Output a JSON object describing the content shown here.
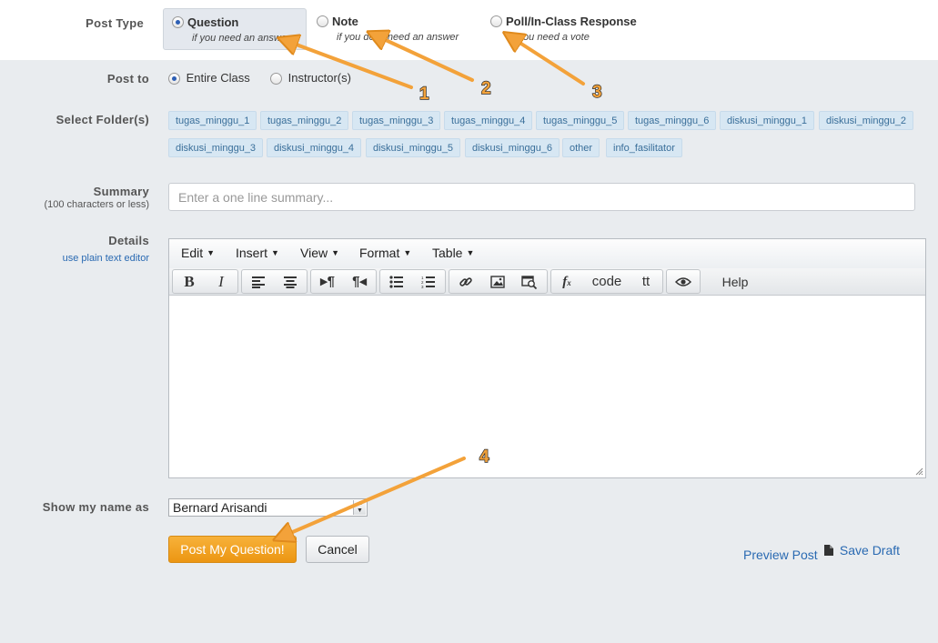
{
  "post_type": {
    "label": "Post Type",
    "options": [
      {
        "title": "Question",
        "desc": "if you need an answer",
        "selected": true
      },
      {
        "title": "Note",
        "desc": "if you don't need an answer",
        "selected": false
      },
      {
        "title": "Poll/In-Class Response",
        "desc": "if you need a vote",
        "selected": false
      }
    ]
  },
  "post_to": {
    "label": "Post to",
    "options": [
      {
        "title": "Entire Class",
        "selected": true
      },
      {
        "title": "Instructor(s)",
        "selected": false
      }
    ]
  },
  "folders": {
    "label": "Select Folder(s)",
    "items": [
      "tugas_minggu_1",
      "tugas_minggu_2",
      "tugas_minggu_3",
      "tugas_minggu_4",
      "tugas_minggu_5",
      "tugas_minggu_6",
      "diskusi_minggu_1",
      "diskusi_minggu_2",
      "diskusi_minggu_3",
      "diskusi_minggu_4",
      "diskusi_minggu_5",
      "diskusi_minggu_6",
      "other",
      "info_fasilitator"
    ]
  },
  "summary": {
    "label": "Summary",
    "sublabel": "(100 characters or less)",
    "placeholder": "Enter a one line summary..."
  },
  "details": {
    "label": "Details",
    "plain_link": "use plain text editor",
    "menus": [
      "Edit",
      "Insert",
      "View",
      "Format",
      "Table"
    ],
    "toolbar": {
      "bold": "B",
      "italic": "I",
      "code": "code",
      "tt": "tt",
      "help": "Help"
    },
    "icons": [
      "bold-icon",
      "italic-icon",
      "align-left-icon",
      "align-center-icon",
      "ltr-icon",
      "rtl-icon",
      "bullet-list-icon",
      "numbered-list-icon",
      "link-icon",
      "image-icon",
      "media-search-icon",
      "formula-icon",
      "code-icon",
      "teletype-icon",
      "preview-eye-icon"
    ]
  },
  "name": {
    "label": "Show my name as",
    "value": "Bernard Arisandi"
  },
  "actions": {
    "post": "Post My Question!",
    "cancel": "Cancel",
    "preview": "Preview Post",
    "save_draft": "Save Draft"
  },
  "annotations": [
    "1",
    "2",
    "3",
    "4"
  ],
  "colors": {
    "accent_orange": "#f3a23a",
    "link_blue": "#2a6ab2",
    "folder_bg": "#d7e7f3"
  }
}
